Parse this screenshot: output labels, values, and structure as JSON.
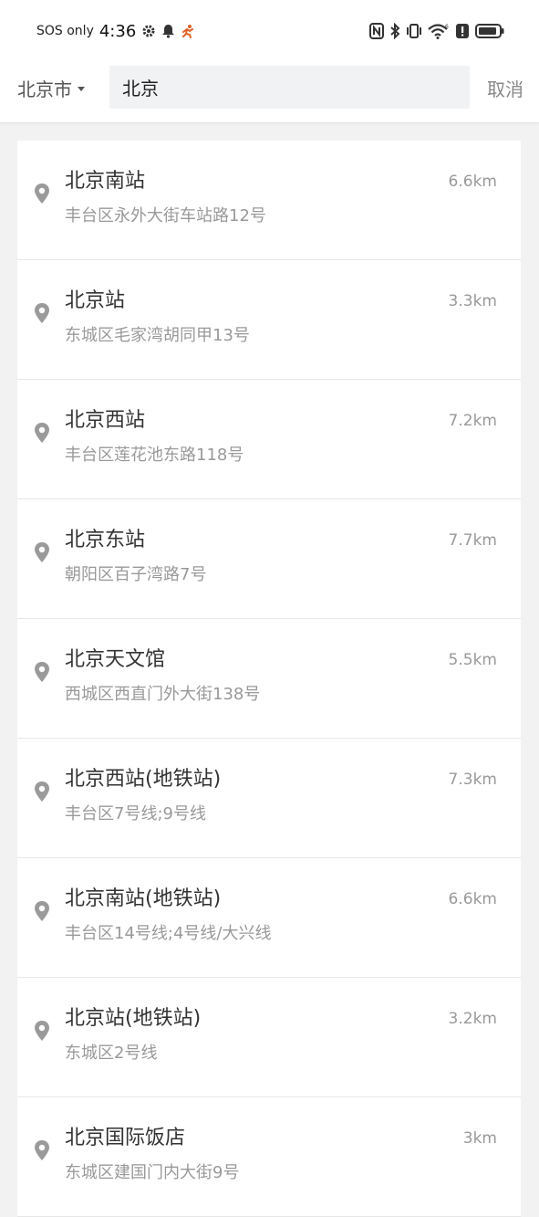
{
  "status_bar": {
    "sos_text": "SOS only",
    "time": "4:36",
    "icons": [
      "settings-gear-icon",
      "notification-bell-icon",
      "running-app-icon",
      "nfc-icon",
      "bluetooth-icon",
      "vibrate-icon",
      "wifi-6-icon",
      "alert-icon",
      "battery-icon"
    ]
  },
  "search": {
    "city": "北京市",
    "query": "北京",
    "cancel_label": "取消"
  },
  "results": [
    {
      "name": "北京南站",
      "address": "丰台区永外大街车站路12号",
      "distance": "6.6km"
    },
    {
      "name": "北京站",
      "address": "东城区毛家湾胡同甲13号",
      "distance": "3.3km"
    },
    {
      "name": "北京西站",
      "address": "丰台区莲花池东路118号",
      "distance": "7.2km"
    },
    {
      "name": "北京东站",
      "address": "朝阳区百子湾路7号",
      "distance": "7.7km"
    },
    {
      "name": "北京天文馆",
      "address": "西城区西直门外大街138号",
      "distance": "5.5km"
    },
    {
      "name": "北京西站(地铁站)",
      "address": "丰台区7号线;9号线",
      "distance": "7.3km"
    },
    {
      "name": "北京南站(地铁站)",
      "address": "丰台区14号线;4号线/大兴线",
      "distance": "6.6km"
    },
    {
      "name": "北京站(地铁站)",
      "address": "东城区2号线",
      "distance": "3.2km"
    },
    {
      "name": "北京国际饭店",
      "address": "东城区建国门内大街9号",
      "distance": "3km"
    }
  ],
  "colors": {
    "background": "#f2f2f2",
    "card": "#ffffff",
    "primary_text": "#333333",
    "secondary_text": "#999999",
    "pin": "#9a9a9a"
  }
}
